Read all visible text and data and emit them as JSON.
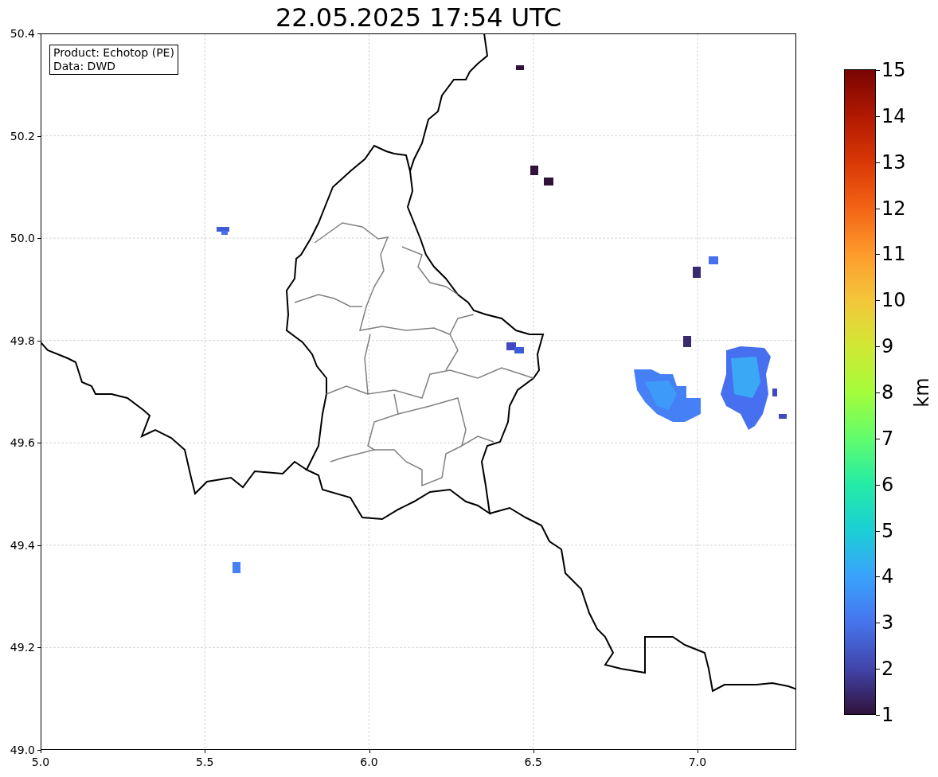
{
  "title": "22.05.2025 17:54 UTC",
  "info_box": [
    "Product: Echotop (PE)",
    "Data: DWD"
  ],
  "x_ticks": [
    "5.0",
    "5.5",
    "6.0",
    "6.5",
    "7.0"
  ],
  "y_ticks": [
    "50.4",
    "50.2",
    "50.0",
    "49.8",
    "49.6",
    "49.4",
    "49.2",
    "49.0"
  ],
  "colorbar": {
    "ticks": [
      "15",
      "14",
      "13",
      "12",
      "11",
      "10",
      "9",
      "8",
      "7",
      "6",
      "5",
      "4",
      "3",
      "2",
      "1"
    ],
    "label": "km"
  }
}
